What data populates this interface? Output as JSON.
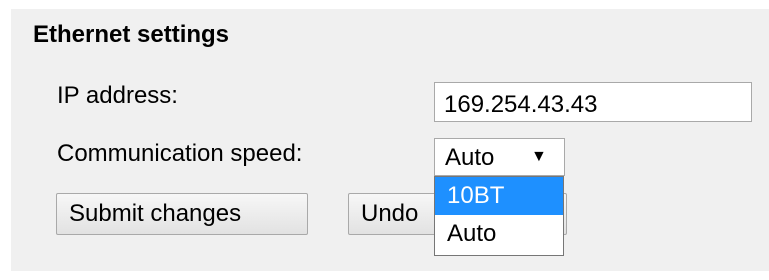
{
  "section": {
    "title": "Ethernet settings"
  },
  "ip_address": {
    "label": "IP address:",
    "value": "169.254.43.43"
  },
  "communication_speed": {
    "label": "Communication speed:",
    "selected_value": "Auto",
    "options": [
      "10BT",
      "Auto"
    ],
    "highlighted_option": "10BT"
  },
  "buttons": {
    "submit_label": "Submit changes",
    "undo_label": "Undo"
  },
  "icons": {
    "dropdown_arrow": "triangle-down-icon"
  },
  "colors": {
    "panel_background": "#f0f0f0",
    "highlight": "#1e90ff"
  }
}
